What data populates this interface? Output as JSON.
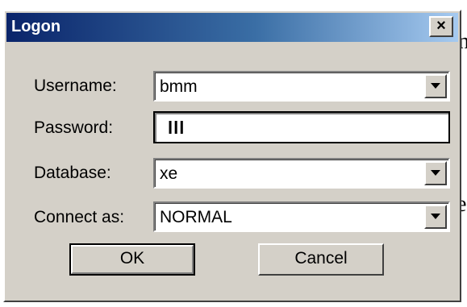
{
  "background": {
    "char_top": "n",
    "char_bottom": "e"
  },
  "window": {
    "title": "Logon",
    "close_glyph": "×"
  },
  "form": {
    "username": {
      "label": "Username:",
      "value": "bmm"
    },
    "password": {
      "label": "Password:",
      "value": "lll"
    },
    "database": {
      "label": "Database:",
      "value": "xe"
    },
    "connect_as": {
      "label": "Connect as:",
      "value": "NORMAL"
    }
  },
  "buttons": {
    "ok_label": "OK",
    "cancel_label": "Cancel"
  },
  "colors": {
    "dialog_face": "#d4d0c8",
    "title_gradient_start": "#0a246a",
    "title_gradient_end": "#a6caf0"
  },
  "icons": {
    "dropdown": "chevron-down-icon",
    "close": "close-icon"
  }
}
